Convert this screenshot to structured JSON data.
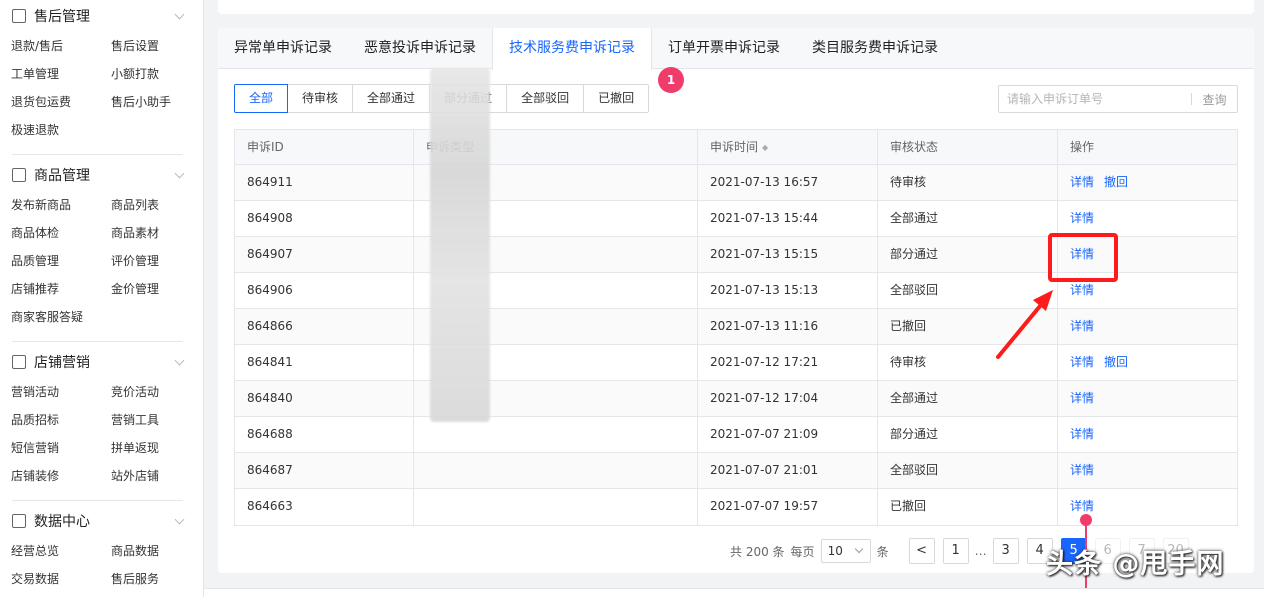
{
  "sidebar": {
    "sections": [
      {
        "title": "售后管理",
        "icon": "shield-check-icon",
        "items": [
          "退款/售后",
          "售后设置",
          "工单管理",
          "小额打款",
          "退货包运费",
          "售后小助手",
          "极速退款"
        ]
      },
      {
        "title": "商品管理",
        "icon": "box-icon",
        "items": [
          "发布新商品",
          "商品列表",
          "商品体检",
          "商品素材",
          "品质管理",
          "评价管理",
          "店铺推荐",
          "金价管理",
          "商家客服答疑"
        ]
      },
      {
        "title": "店铺营销",
        "icon": "gift-icon",
        "items": [
          "营销活动",
          "竞价活动",
          "品质招标",
          "营销工具",
          "短信营销",
          "拼单返现",
          "店铺装修",
          "站外店铺"
        ]
      },
      {
        "title": "数据中心",
        "icon": "bar-chart-icon",
        "items": [
          "经营总览",
          "商品数据",
          "交易数据",
          "售后服务"
        ]
      }
    ]
  },
  "tabs": [
    "异常单申诉记录",
    "恶意投诉申诉记录",
    "技术服务费申诉记录",
    "订单开票申诉记录",
    "类目服务费申诉记录"
  ],
  "active_tab": 2,
  "filters": [
    "全部",
    "待审核",
    "全部通过",
    "部分通过",
    "全部驳回",
    "已撤回"
  ],
  "active_filter": 0,
  "badge": "1",
  "search": {
    "placeholder": "请输入申诉订单号",
    "button": "查询"
  },
  "table": {
    "headers": [
      "申诉ID",
      "申诉类型",
      "申诉时间",
      "审核状态",
      "操作"
    ],
    "sort_glyph": "◆",
    "rows": [
      {
        "id": "864911",
        "type": "",
        "time": "2021-07-13 16:57",
        "status": "待审核",
        "actions": [
          "详情",
          "撤回"
        ]
      },
      {
        "id": "864908",
        "type": "",
        "time": "2021-07-13 15:44",
        "status": "全部通过",
        "actions": [
          "详情"
        ]
      },
      {
        "id": "864907",
        "type": "",
        "time": "2021-07-13 15:15",
        "status": "部分通过",
        "actions": [
          "详情"
        ]
      },
      {
        "id": "864906",
        "type": "",
        "time": "2021-07-13 15:13",
        "status": "全部驳回",
        "actions": [
          "详情"
        ]
      },
      {
        "id": "864866",
        "type": "",
        "time": "2021-07-13 11:16",
        "status": "已撤回",
        "actions": [
          "详情"
        ]
      },
      {
        "id": "864841",
        "type": "",
        "time": "2021-07-12 17:21",
        "status": "待审核",
        "actions": [
          "详情",
          "撤回"
        ]
      },
      {
        "id": "864840",
        "type": "",
        "time": "2021-07-12 17:04",
        "status": "全部通过",
        "actions": [
          "详情"
        ]
      },
      {
        "id": "864688",
        "type": "",
        "time": "2021-07-07 21:09",
        "status": "部分通过",
        "actions": [
          "详情"
        ]
      },
      {
        "id": "864687",
        "type": "",
        "time": "2021-07-07 21:01",
        "status": "全部驳回",
        "actions": [
          "详情"
        ]
      },
      {
        "id": "864663",
        "type": "",
        "time": "2021-07-07 19:57",
        "status": "已撤回",
        "actions": [
          "详情"
        ]
      }
    ]
  },
  "pagination": {
    "total_text": "共 200 条",
    "per_page_label": "每页",
    "per_page": "10",
    "per_page_suffix": "条",
    "prev": "<",
    "pages": [
      "1",
      "…",
      "3",
      "4",
      "5",
      "6",
      "7",
      "20"
    ],
    "current": "5"
  },
  "watermark": "头条 @甩手网"
}
